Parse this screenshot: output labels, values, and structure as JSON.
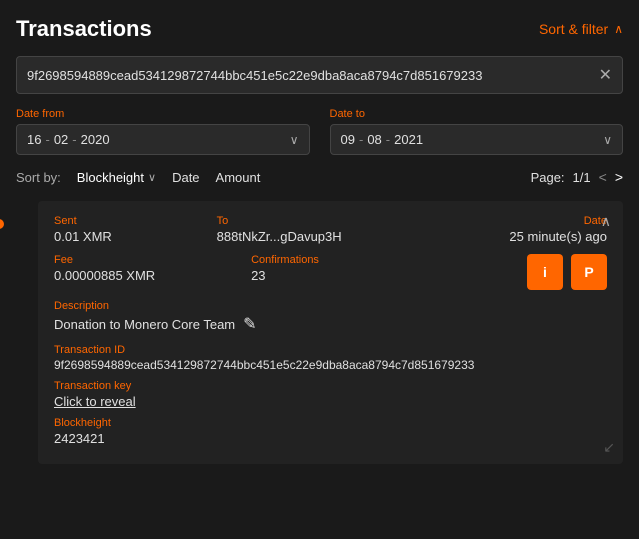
{
  "header": {
    "title": "Transactions",
    "sort_filter_label": "Sort & filter",
    "chevron": "∧"
  },
  "search": {
    "value": "9f2698594889cead534129872744bbc451e5c22e9dba8aca8794c7d851679233",
    "clear_icon": "✕"
  },
  "date_from": {
    "label": "Date from",
    "day": "16",
    "separator1": "-",
    "month": "02",
    "separator2": "-",
    "year": "2020",
    "chevron": "∨"
  },
  "date_to": {
    "label": "Date to",
    "day": "09",
    "separator1": "-",
    "month": "08",
    "separator2": "-",
    "year": "2021",
    "chevron": "∨"
  },
  "sort_bar": {
    "label": "Sort by:",
    "options": [
      {
        "id": "blockheight",
        "label": "Blockheight",
        "has_chevron": true
      },
      {
        "id": "date",
        "label": "Date",
        "has_chevron": false
      },
      {
        "id": "amount",
        "label": "Amount",
        "has_chevron": false
      }
    ],
    "page_label": "Page:",
    "page_value": "1/1",
    "prev_icon": "<",
    "next_icon": ">"
  },
  "transaction": {
    "type_label": "Sent",
    "amount": "0.01 XMR",
    "to_label": "To",
    "to_address": "888tNkZr...gDavup3H",
    "date_label": "Date",
    "date_value": "25 minute(s) ago",
    "fee_label": "Fee",
    "fee_value": "0.00000885 XMR",
    "confirmations_label": "Confirmations",
    "confirmations_value": "23",
    "description_label": "Description",
    "description_value": "Donation to Monero Core Team",
    "tx_id_label": "Transaction ID",
    "tx_id_value": "9f2698594889cead534129872744bbc451e5c22e9dba8aca8794c7d851679233",
    "tx_key_label": "Transaction key",
    "tx_key_value": "Click to reveal",
    "blockheight_label": "Blockheight",
    "blockheight_value": "2423421",
    "info_btn": "i",
    "proof_btn": "P",
    "edit_icon": "✎"
  },
  "colors": {
    "accent": "#ff6600",
    "bg_dark": "#1a1a1a",
    "bg_card": "#222222",
    "text_primary": "#e0e0e0",
    "text_muted": "#aaaaaa"
  }
}
